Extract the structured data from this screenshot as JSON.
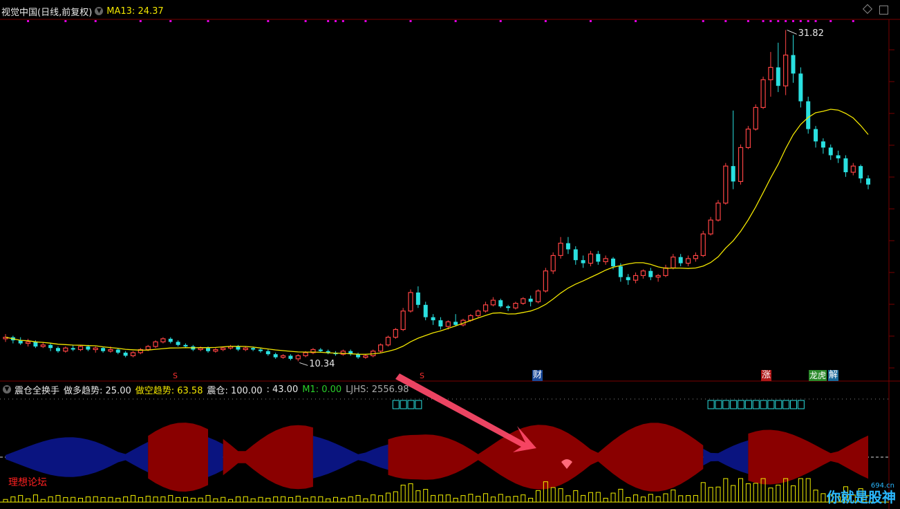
{
  "header": {
    "stock_name": "视觉中国(日线,前复权)",
    "ma_label": "MA13: 24.37",
    "ma_color": "#f2e600"
  },
  "price_chart": {
    "high_label": "31.82",
    "low_label": "10.34",
    "ma_period": 13
  },
  "event_tags": [
    {
      "id": "s1",
      "text": "S"
    },
    {
      "id": "s2",
      "text": "S"
    },
    {
      "id": "cai",
      "text": "财"
    },
    {
      "id": "zhang",
      "text": "涨"
    },
    {
      "id": "longhu",
      "text": "龙虎"
    },
    {
      "id": "jie",
      "text": "解"
    }
  ],
  "indicator": {
    "name": "震仓全换手",
    "long_label": "做多趋势: 25.00",
    "short_label": "做空趋势: 63.58",
    "zc_label": "震仓: 100.00",
    "sep_label": ": 43.00",
    "m1_label": "M1: 0.00",
    "ljhs_label": "LJHS: 2556.98"
  },
  "overlay": {
    "forum_text": "理想论坛",
    "watermark_text": "你就是股神",
    "watermark_site": "694.cn"
  },
  "colors": {
    "up": "#ff4444",
    "down": "#2ae0e0",
    "red_area": "#8a0000",
    "blue_area": "#0a1480",
    "volume": "#f2f000",
    "dots": "#e000e0",
    "arrow": "#ff4a6a"
  },
  "chart_data": {
    "type": "candlestick",
    "note_units": "price in CNY",
    "ma13_last": 24.37,
    "max_price": 31.82,
    "min_price": 10.34,
    "candles": [
      [
        11.8,
        11.9,
        12.1,
        11.6
      ],
      [
        11.9,
        11.7,
        12.0,
        11.5
      ],
      [
        11.7,
        11.5,
        11.9,
        11.4
      ],
      [
        11.5,
        11.6,
        11.8,
        11.3
      ],
      [
        11.6,
        11.3,
        11.7,
        11.2
      ],
      [
        11.3,
        11.4,
        11.6,
        11.2
      ],
      [
        11.4,
        11.2,
        11.5,
        11.0
      ],
      [
        11.2,
        11.0,
        11.3,
        10.9
      ],
      [
        11.0,
        11.2,
        11.3,
        10.9
      ],
      [
        11.2,
        11.1,
        11.4,
        11.0
      ],
      [
        11.1,
        11.3,
        11.4,
        11.0
      ],
      [
        11.3,
        11.1,
        11.4,
        11.0
      ],
      [
        11.1,
        11.2,
        11.3,
        10.9
      ],
      [
        11.2,
        11.0,
        11.3,
        10.9
      ],
      [
        11.0,
        11.1,
        11.3,
        10.9
      ],
      [
        11.1,
        10.9,
        11.2,
        10.8
      ],
      [
        10.9,
        10.7,
        11.0,
        10.6
      ],
      [
        10.7,
        10.9,
        11.0,
        10.6
      ],
      [
        10.9,
        11.1,
        11.2,
        10.8
      ],
      [
        11.1,
        11.3,
        11.4,
        11.0
      ],
      [
        11.3,
        11.6,
        11.7,
        11.2
      ],
      [
        11.6,
        11.8,
        11.9,
        11.5
      ],
      [
        11.8,
        11.6,
        11.9,
        11.5
      ],
      [
        11.6,
        11.4,
        11.7,
        11.3
      ],
      [
        11.4,
        11.3,
        11.5,
        11.2
      ],
      [
        11.3,
        11.1,
        11.4,
        11.0
      ],
      [
        11.1,
        11.2,
        11.3,
        11.0
      ],
      [
        11.2,
        11.0,
        11.3,
        10.9
      ],
      [
        11.0,
        11.1,
        11.2,
        10.9
      ],
      [
        11.1,
        11.2,
        11.3,
        11.0
      ],
      [
        11.2,
        11.3,
        11.4,
        11.1
      ],
      [
        11.3,
        11.1,
        11.4,
        11.0
      ],
      [
        11.1,
        11.2,
        11.3,
        11.0
      ],
      [
        11.2,
        11.1,
        11.3,
        11.0
      ],
      [
        11.1,
        11.0,
        11.2,
        10.9
      ],
      [
        11.0,
        10.8,
        11.1,
        10.7
      ],
      [
        10.8,
        10.6,
        10.9,
        10.5
      ],
      [
        10.6,
        10.7,
        10.8,
        10.5
      ],
      [
        10.7,
        10.5,
        10.8,
        10.4
      ],
      [
        10.5,
        10.7,
        10.8,
        10.34
      ],
      [
        10.7,
        10.9,
        11.0,
        10.6
      ],
      [
        10.9,
        11.1,
        11.2,
        10.8
      ],
      [
        11.1,
        11.0,
        11.2,
        10.9
      ],
      [
        11.0,
        10.9,
        11.1,
        10.8
      ],
      [
        10.9,
        10.8,
        11.0,
        10.7
      ],
      [
        10.8,
        11.0,
        11.1,
        10.7
      ],
      [
        11.0,
        10.8,
        11.1,
        10.7
      ],
      [
        10.8,
        10.6,
        10.9,
        10.5
      ],
      [
        10.6,
        10.7,
        10.8,
        10.5
      ],
      [
        10.7,
        11.0,
        11.1,
        10.6
      ],
      [
        11.0,
        11.4,
        11.5,
        10.9
      ],
      [
        11.4,
        11.9,
        12.0,
        11.3
      ],
      [
        11.9,
        12.4,
        12.5,
        11.8
      ],
      [
        12.4,
        13.6,
        13.8,
        12.3
      ],
      [
        13.6,
        14.8,
        15.0,
        13.5
      ],
      [
        14.8,
        14.0,
        15.2,
        13.8
      ],
      [
        14.0,
        13.2,
        14.2,
        13.0
      ],
      [
        13.2,
        13.0,
        13.4,
        12.7
      ],
      [
        13.0,
        12.6,
        13.2,
        12.4
      ],
      [
        12.6,
        12.9,
        13.0,
        12.4
      ],
      [
        12.9,
        12.7,
        13.4,
        12.6
      ],
      [
        12.7,
        13.0,
        13.1,
        12.6
      ],
      [
        13.0,
        13.3,
        13.4,
        12.9
      ],
      [
        13.3,
        13.6,
        13.7,
        13.2
      ],
      [
        13.6,
        14.0,
        14.2,
        13.5
      ],
      [
        14.0,
        14.3,
        14.5,
        13.9
      ],
      [
        14.3,
        13.9,
        14.4,
        13.8
      ],
      [
        13.9,
        13.8,
        14.0,
        13.6
      ],
      [
        13.8,
        14.1,
        14.2,
        13.7
      ],
      [
        14.1,
        14.4,
        14.5,
        14.0
      ],
      [
        14.4,
        14.2,
        14.6,
        13.9
      ],
      [
        14.2,
        14.9,
        15.0,
        14.1
      ],
      [
        14.9,
        16.2,
        16.4,
        14.8
      ],
      [
        16.2,
        17.2,
        17.4,
        16.0
      ],
      [
        17.2,
        18.0,
        18.4,
        17.0
      ],
      [
        18.0,
        17.6,
        18.4,
        17.3
      ],
      [
        17.6,
        16.9,
        17.8,
        16.6
      ],
      [
        16.9,
        16.7,
        17.2,
        16.4
      ],
      [
        16.7,
        17.3,
        17.5,
        16.5
      ],
      [
        17.3,
        16.8,
        17.5,
        16.6
      ],
      [
        16.8,
        17.0,
        17.2,
        16.6
      ],
      [
        17.0,
        16.5,
        17.1,
        16.3
      ],
      [
        16.5,
        15.8,
        16.7,
        15.5
      ],
      [
        15.8,
        15.6,
        16.0,
        15.3
      ],
      [
        15.6,
        15.9,
        16.1,
        15.4
      ],
      [
        15.9,
        16.2,
        16.3,
        15.7
      ],
      [
        16.2,
        15.8,
        16.4,
        15.6
      ],
      [
        15.8,
        15.9,
        16.0,
        15.5
      ],
      [
        15.9,
        16.4,
        16.6,
        15.8
      ],
      [
        16.4,
        17.1,
        17.3,
        16.3
      ],
      [
        17.1,
        16.7,
        17.3,
        16.5
      ],
      [
        16.7,
        17.0,
        17.2,
        16.5
      ],
      [
        17.0,
        17.2,
        17.4,
        16.8
      ],
      [
        17.2,
        18.6,
        18.8,
        17.1
      ],
      [
        18.6,
        19.5,
        19.7,
        18.5
      ],
      [
        19.5,
        20.6,
        20.8,
        19.4
      ],
      [
        20.6,
        23.0,
        23.2,
        20.5
      ],
      [
        23.0,
        22.0,
        26.6,
        21.5
      ],
      [
        22.0,
        24.2,
        24.4,
        21.8
      ],
      [
        24.2,
        25.4,
        25.6,
        24.1
      ],
      [
        25.4,
        26.8,
        27.0,
        25.3
      ],
      [
        26.8,
        28.6,
        28.8,
        26.7
      ],
      [
        28.6,
        29.4,
        30.4,
        27.5
      ],
      [
        29.4,
        28.2,
        31.0,
        27.8
      ],
      [
        28.2,
        30.2,
        31.82,
        27.6
      ],
      [
        30.2,
        29.0,
        31.5,
        28.4
      ],
      [
        29.0,
        27.2,
        29.4,
        26.8
      ],
      [
        27.2,
        25.4,
        27.5,
        25.1
      ],
      [
        25.4,
        24.6,
        25.6,
        24.2
      ],
      [
        24.6,
        24.2,
        24.8,
        23.8
      ],
      [
        24.2,
        23.7,
        24.4,
        23.4
      ],
      [
        23.7,
        23.5,
        24.0,
        23.2
      ],
      [
        23.5,
        22.6,
        23.7,
        22.3
      ],
      [
        22.6,
        23.0,
        23.2,
        22.4
      ],
      [
        23.0,
        22.2,
        23.1,
        21.9
      ],
      [
        22.2,
        21.8,
        22.4,
        21.5
      ]
    ]
  }
}
